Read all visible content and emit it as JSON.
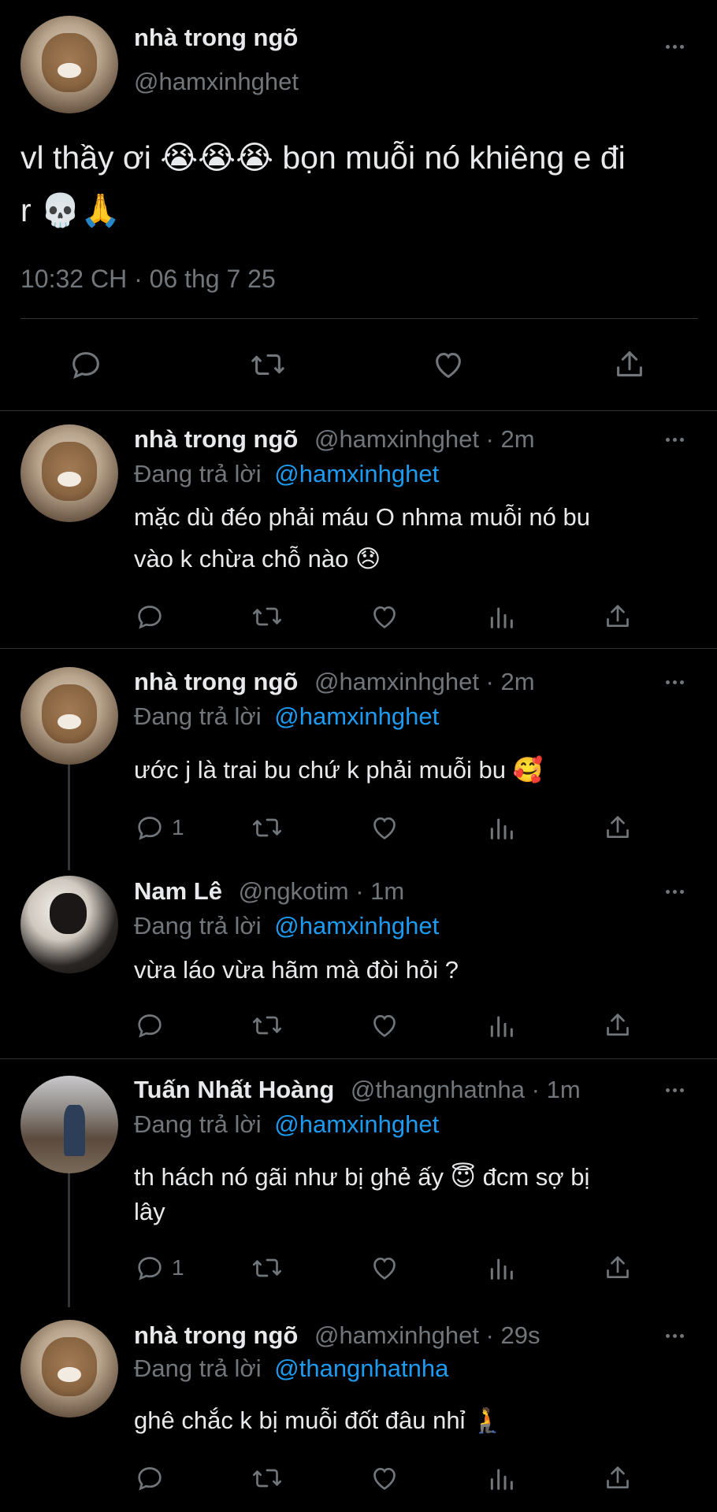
{
  "main_tweet": {
    "name": "nhà trong ngõ",
    "handle": "@hamxinhghet",
    "line1": "vl thầy ơi 😭😭😭  bọn muỗi nó khiêng e đi",
    "line2": "r 💀🙏",
    "timestamp": "10:32 CH · 06 thg 7 25"
  },
  "replying_label": "Đang trả lời",
  "replies": [
    {
      "name": "nhà trong ngõ",
      "meta": "@hamxinhghet · 2m",
      "reply_to": "@hamxinhghet",
      "line1": "mặc dù đéo phải máu O nhma muỗi nó bu",
      "line2": "vào k chừa chỗ nào 😞",
      "reply_count": ""
    },
    {
      "name": "nhà trong ngõ",
      "meta": "@hamxinhghet · 2m",
      "reply_to": "@hamxinhghet",
      "line1": "ước j là trai bu chứ k phải muỗi bu 🥰",
      "line2": "",
      "reply_count": "1"
    },
    {
      "name": "Nam Lê",
      "meta": "@ngkotim · 1m",
      "reply_to": "@hamxinhghet",
      "line1": "vừa láo vừa hãm mà đòi hỏi ?",
      "line2": "",
      "reply_count": ""
    },
    {
      "name": "Tuấn Nhất Hoàng",
      "meta": "@thangnhatnha · 1m",
      "reply_to": "@hamxinhghet",
      "line1": "th hách nó gãi như bị ghẻ ấy 😇  đcm sợ bị",
      "line2": "lây",
      "reply_count": "1"
    },
    {
      "name": "nhà trong ngõ",
      "meta": "@hamxinhghet · 29s",
      "reply_to": "@thangnhatnha",
      "line1": "ghê chắc k bị muỗi đốt đâu nhỉ 🧎",
      "line2": "",
      "reply_count": ""
    }
  ],
  "colors": {
    "background": "#000000",
    "text": "#e7e9ea",
    "muted": "#71767b",
    "link": "#1d9bf0",
    "divider": "#2f3336"
  }
}
